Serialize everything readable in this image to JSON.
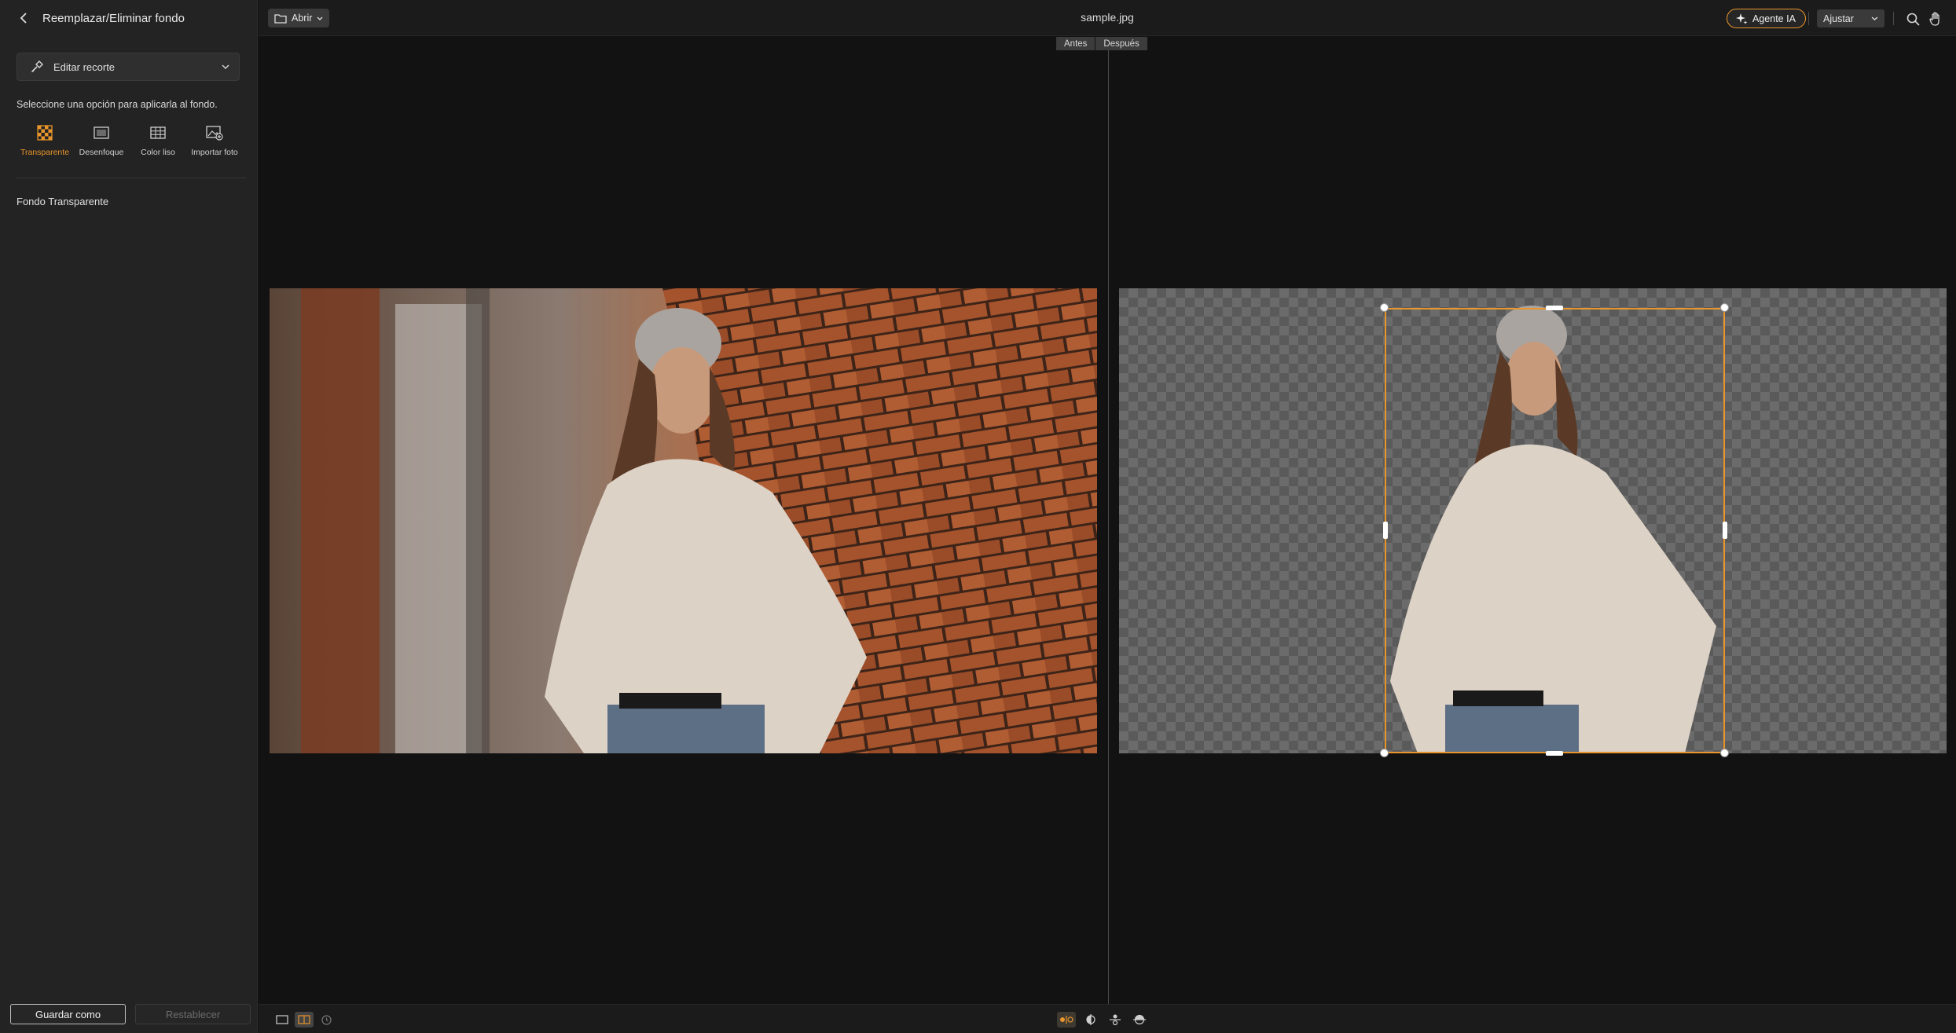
{
  "sidebar": {
    "title": "Reemplazar/Eliminar fondo",
    "edit_cutout_label": "Editar recorte",
    "instruction": "Seleccione una opción para aplicarla al fondo.",
    "options": [
      {
        "label": "Transparente",
        "icon": "checker-icon",
        "active": true
      },
      {
        "label": "Desenfoque",
        "icon": "blur-icon",
        "active": false
      },
      {
        "label": "Color liso",
        "icon": "grid-icon",
        "active": false
      },
      {
        "label": "Importar foto",
        "icon": "image-import-icon",
        "active": false
      }
    ],
    "section_label": "Fondo Transparente",
    "save_as_label": "Guardar como",
    "reset_label": "Restablecer"
  },
  "topbar": {
    "open_label": "Abrir",
    "file_name": "sample.jpg",
    "ai_agent_label": "Agente IA",
    "zoom_label": "Ajustar"
  },
  "canvas": {
    "before_label": "Antes",
    "after_label": "Después"
  },
  "colors": {
    "accent": "#e8952b",
    "sidebar_bg": "#232323",
    "canvas_bg": "#121212"
  }
}
